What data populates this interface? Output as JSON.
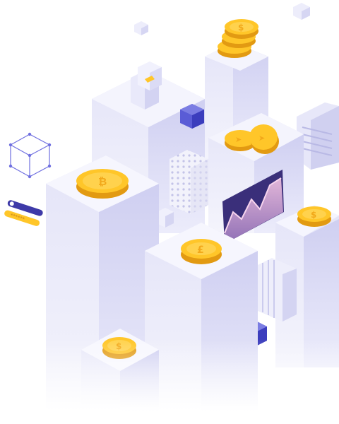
{
  "illustration": {
    "colors": {
      "background": "#ffffff",
      "block_top": "#f3f3fd",
      "block_left": "#dcdcf5",
      "block_right": "#c9c9ee",
      "accent_cube": "#4d4fd1",
      "coin_face": "#ffc629",
      "coin_edge": "#e29a12",
      "coin_symbol": "#f6b31b",
      "wireframe": "#6f6fe0",
      "chart_panel": "#3a2f7a",
      "chart_area": "#c9a3c9"
    },
    "coins": [
      {
        "symbol": "bitcoin-icon"
      },
      {
        "symbol": "dollar-icon"
      },
      {
        "symbol": "dollar-icon"
      },
      {
        "symbol": "dollar-icon"
      },
      {
        "symbol": "pound-icon"
      },
      {
        "symbol": "dollar-icon"
      },
      {
        "symbol": "arrow-icon"
      },
      {
        "symbol": "arrow-icon"
      }
    ],
    "chart_shape": "area-line",
    "login_widget": {
      "fields": 2
    }
  }
}
